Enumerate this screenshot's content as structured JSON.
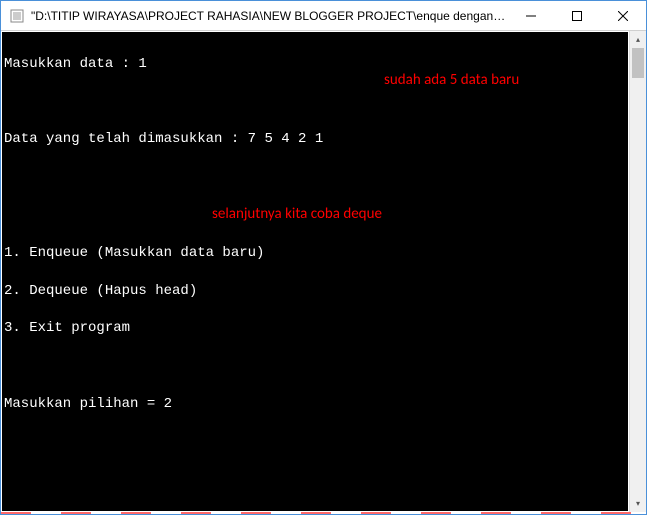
{
  "window": {
    "title": "\"D:\\TITIP WIRAYASA\\PROJECT RAHASIA\\NEW BLOGGER PROJECT\\enque dengan link lis..."
  },
  "console": {
    "line1_prompt": "Masukkan data : ",
    "line1_value": "1",
    "line2_prompt": "Data yang telah dimasukkan : ",
    "line2_value": "7 5 4 2 1",
    "menu1": "1. Enqueue (Masukkan data baru)",
    "menu2": "2. Dequeue (Hapus head)",
    "menu3": "3. Exit program",
    "choice_prompt": "Masukkan pilihan = ",
    "choice_value": "2"
  },
  "annotations": {
    "a1": "sudah ada 5 data baru",
    "a2": "selanjutnya kita coba deque"
  },
  "scrollbar": {
    "up": "▴",
    "down": "▾"
  }
}
